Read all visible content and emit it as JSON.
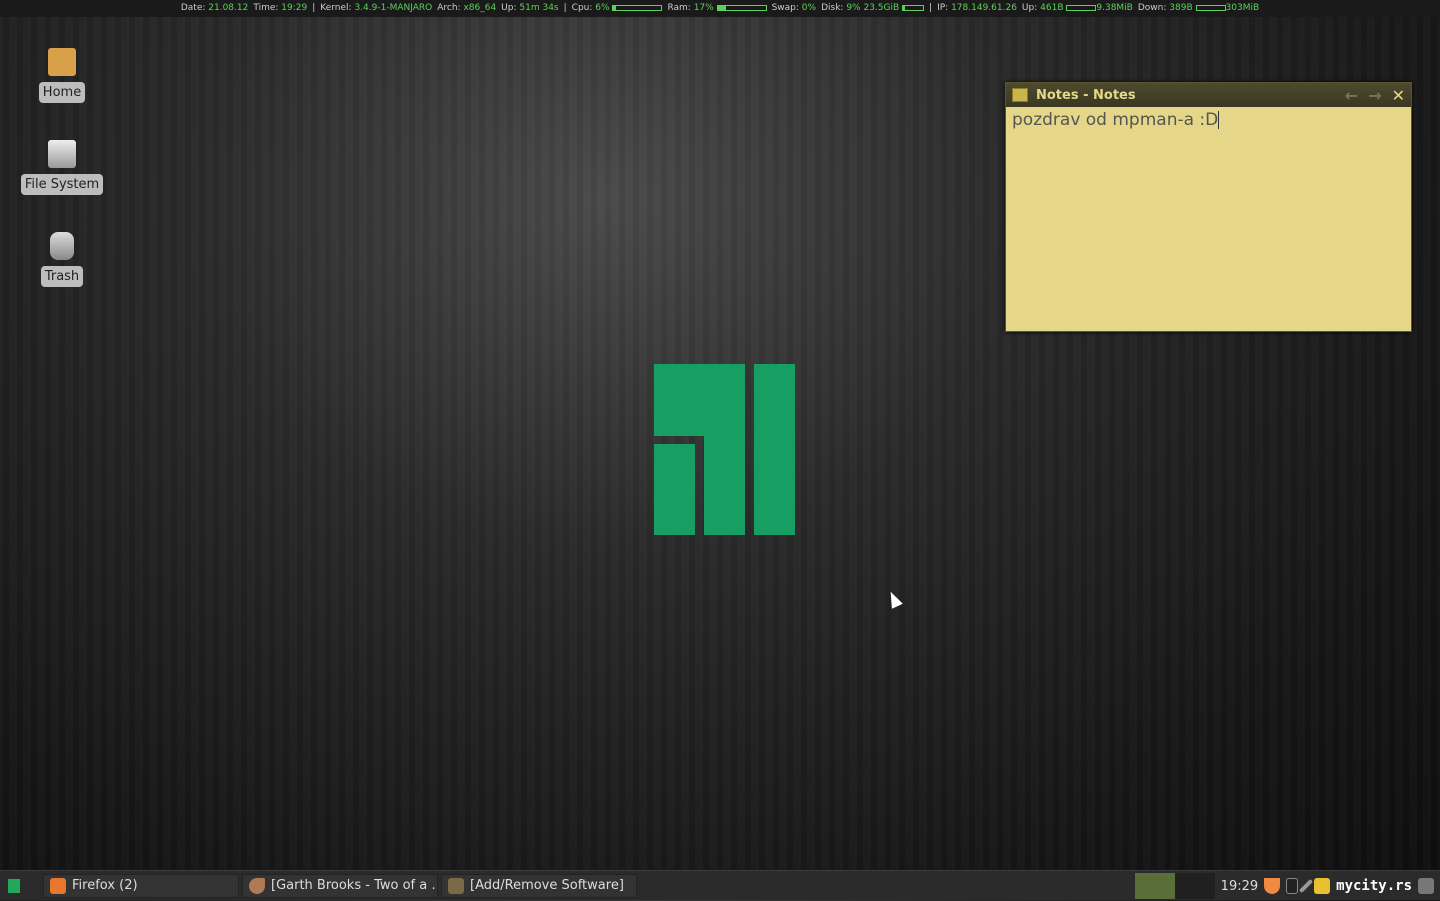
{
  "conky": {
    "date_label": "Date:",
    "date": "21.08.12",
    "time_label": "Time:",
    "time": "19:29",
    "kernel_label": "Kernel:",
    "kernel": "3.4.9-1-MANJARO",
    "arch_label": "Arch:",
    "arch": "x86_64",
    "up_label": "Up:",
    "uptime": "51m 34s",
    "cpu_label": "Cpu:",
    "cpu": "6%",
    "cpu_fraction": 0.06,
    "ram_label": "Ram:",
    "ram": "17%",
    "ram_fraction": 0.17,
    "swap_label": "Swap:",
    "swap": "0%",
    "disk_label": "Disk:",
    "disk": "9% 23.5GiB",
    "disk_fraction": 0.09,
    "ip_label": "IP:",
    "ip": "178.149.61.26",
    "netup_label": "Up:",
    "netup": "461B",
    "netup_total": "9.38MiB",
    "down_label": "Down:",
    "down": "389B",
    "down_total": "303MiB",
    "sep": "|",
    "accent": "#5bd05b"
  },
  "desktop": {
    "icons": [
      {
        "label": "Home",
        "icon": "home-folder-icon"
      },
      {
        "label": "File System",
        "icon": "drive-icon"
      },
      {
        "label": "Trash",
        "icon": "trash-icon"
      }
    ]
  },
  "notes": {
    "title": "Notes - Notes",
    "text": "pozdrav od mpman-a :D",
    "back": "←",
    "forward": "→",
    "close": "✕"
  },
  "taskbar": {
    "tasks": [
      {
        "label": "Firefox (2)",
        "icon": "firefox-icon"
      },
      {
        "label": "[Garth Brooks - Two of a …",
        "icon": "music-player-icon"
      },
      {
        "label": "[Add/Remove Software]",
        "icon": "package-icon"
      }
    ],
    "clock": "19:29",
    "watermark": "mycity.rs"
  }
}
